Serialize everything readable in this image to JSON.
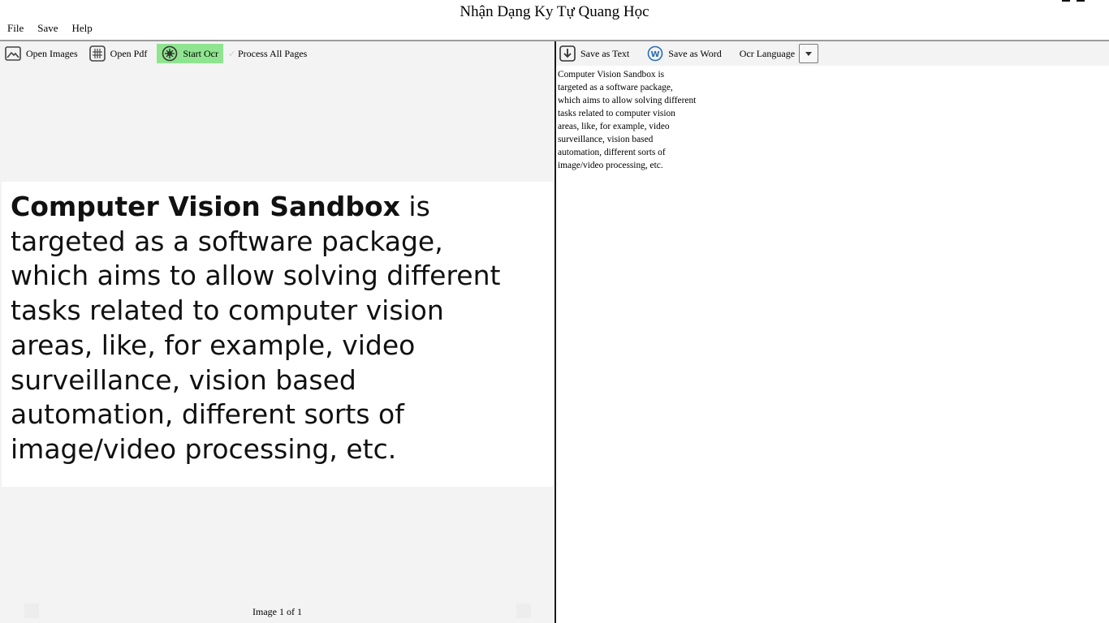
{
  "window": {
    "title": "Nhận Dạng Ky Tự Quang Học"
  },
  "menu": [
    "File",
    "Save",
    "Help"
  ],
  "left_toolbar": {
    "open_images": "Open Images",
    "open_pdf": "Open Pdf",
    "start_ocr": "Start Ocr",
    "process_all_pages": "Process All Pages"
  },
  "image_text": {
    "bold_part": "Computer Vision Sandbox",
    "lines": [
      " is",
      "targeted as a software package,",
      "which aims to allow solving different",
      "tasks related to computer vision",
      "areas, like, for example, video",
      "surveillance, vision based",
      "automation, different sorts of",
      "image/video processing, etc."
    ]
  },
  "pager": {
    "label": "Image 1 of 1"
  },
  "right_toolbar": {
    "save_text": "Save as Text",
    "save_word": "Save as Word",
    "ocr_language": "Ocr Language"
  },
  "ocr_output": [
    "Computer Vision Sandbox is",
    "targeted as a software package,",
    "which aims to allow solving different",
    "tasks related to computer vision",
    "areas, like, for example, video",
    "surveillance, vision based",
    "automation, different sorts of",
    "image/video processing, etc."
  ],
  "colors": {
    "active_button": "#8fe58f",
    "pane_bg": "#f3f3f3",
    "divider": "#1a1a1a"
  }
}
